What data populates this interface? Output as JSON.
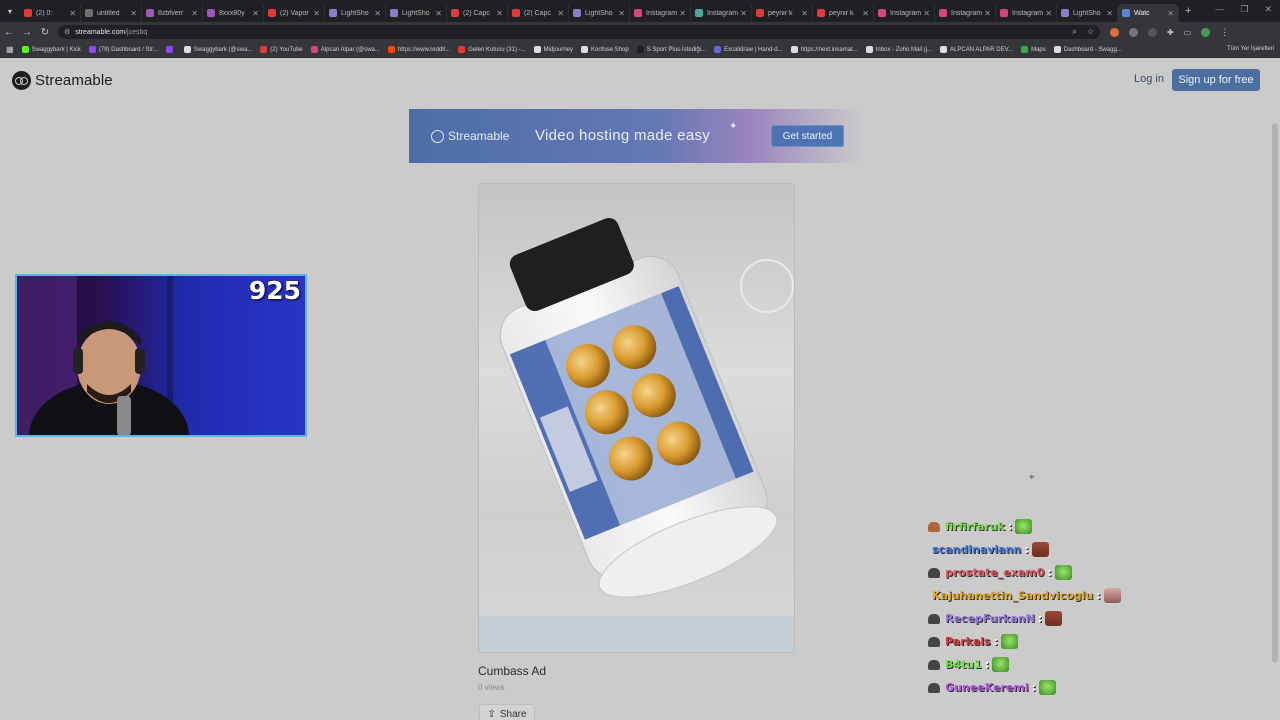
{
  "browser": {
    "tabs": [
      {
        "label": "(2) 0:",
        "color": "#e23a3a"
      },
      {
        "label": "untitled",
        "color": "#6f6f6f"
      },
      {
        "label": "8zbfverr",
        "color": "#9b59b6"
      },
      {
        "label": "8xxx80y",
        "color": "#9b59b6"
      },
      {
        "label": "(2) Vapor",
        "color": "#e23a3a"
      },
      {
        "label": "LightSho",
        "color": "#8a7ec9"
      },
      {
        "label": "LightSho",
        "color": "#8a7ec9"
      },
      {
        "label": "(2) Capc",
        "color": "#e23a3a"
      },
      {
        "label": "(2) Capc",
        "color": "#e23a3a"
      },
      {
        "label": "LightSho",
        "color": "#8a7ec9"
      },
      {
        "label": "Instagram",
        "color": "#d6447a"
      },
      {
        "label": "Instagram",
        "color": "#4aa8a0"
      },
      {
        "label": "peynir k",
        "color": "#e23a3a"
      },
      {
        "label": "peynir k",
        "color": "#e23a3a"
      },
      {
        "label": "Instagram",
        "color": "#d6447a"
      },
      {
        "label": "Instagram",
        "color": "#d6447a"
      },
      {
        "label": "Instagram",
        "color": "#d6447a"
      },
      {
        "label": "LightSho",
        "color": "#8a7ec9"
      },
      {
        "label": "Watc",
        "color": "#5a86d6",
        "active": true
      }
    ],
    "new_tab": "+",
    "url_host": "streamable.com",
    "url_path": "/jcesbq",
    "bookmarks": [
      {
        "label": "Swaggybark | Kick",
        "color": "#53fc18"
      },
      {
        "label": "(79) Dashboard / Str...",
        "color": "#9146ff"
      },
      {
        "label": "",
        "color": "#9146ff"
      },
      {
        "label": "Swaggybark (@swa...",
        "color": "#dddddd"
      },
      {
        "label": "(2) YouTube",
        "color": "#e23a3a"
      },
      {
        "label": "Alpcan Alpar (@swa...",
        "color": "#d6447a"
      },
      {
        "label": "https://www.reddit...",
        "color": "#ff4500"
      },
      {
        "label": "Gelen Kutusu (31) -...",
        "color": "#e23a3a"
      },
      {
        "label": "Midjourney",
        "color": "#dddddd"
      },
      {
        "label": "Konfuse Shop",
        "color": "#dddddd"
      },
      {
        "label": "S Sport Plus-İstediği...",
        "color": "#1f1f1f"
      },
      {
        "label": "Excalidraw | Hand-d...",
        "color": "#6965db"
      },
      {
        "label": "https://next.inkamat...",
        "color": "#dddddd"
      },
      {
        "label": "Inbox - Zoho Mail (j...",
        "color": "#dddddd"
      },
      {
        "label": "ALPCAN ALPAR DEV...",
        "color": "#dddddd"
      },
      {
        "label": "Maps",
        "color": "#34a853"
      },
      {
        "label": "Dashboard - Swagg...",
        "color": "#dddddd"
      }
    ],
    "bookmarks_right": "Tüm Yer İşaretleri"
  },
  "site": {
    "logo_text": "Streamable",
    "login": "Log in",
    "signup": "Sign up for free",
    "banner": {
      "logo_text": "Streamable",
      "tagline": "Video hosting made easy",
      "cta": "Get started"
    },
    "video": {
      "title": "Cumbass Ad",
      "views": "0 views",
      "share": "Share"
    }
  },
  "stream_overlay": {
    "webcam_count": "925",
    "chat": [
      {
        "user": "firfirfaruk",
        "color": "#7ed957",
        "badge": "flame",
        "emote": "frog"
      },
      {
        "user": "scandinaviann",
        "color": "#4a78d6",
        "badge": "none",
        "emote": "brown"
      },
      {
        "user": "prostate_exam0",
        "color": "#e0556b",
        "badge": "hat",
        "emote": "frog"
      },
      {
        "user": "Kajuhanettin_Sandvicoglu",
        "color": "#e0a72a",
        "badge": "none",
        "emote": "face"
      },
      {
        "user": "RecepFurkanN",
        "color": "#9b7ae0",
        "badge": "hat",
        "emote": "brown"
      },
      {
        "user": "Parkals",
        "color": "#d43b3b",
        "badge": "hat",
        "emote": "frog"
      },
      {
        "user": "B4tu1",
        "color": "#6ee04a",
        "badge": "hat",
        "emote": "frog"
      },
      {
        "user": "GuneeKeremi",
        "color": "#b25ee0",
        "badge": "hat",
        "emote": "frog"
      }
    ],
    "chat_separator": ":"
  }
}
